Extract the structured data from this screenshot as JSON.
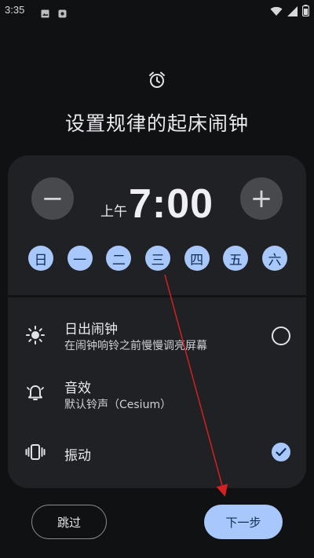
{
  "status_bar": {
    "time": "3:35"
  },
  "header": {
    "title": "设置规律的起床闹钟"
  },
  "alarm": {
    "ampm": "上午",
    "time": "7:00",
    "decrease_symbol": "−",
    "increase_symbol": "+",
    "days": [
      "日",
      "一",
      "二",
      "三",
      "四",
      "五",
      "六"
    ]
  },
  "options": [
    {
      "label": "日出闹钟",
      "sub": "在闹钟响铃之前慢慢调亮屏幕",
      "icon": "sun-icon",
      "state": "unchecked"
    },
    {
      "label": "音效",
      "sub": "默认铃声（Cesium）",
      "icon": "bell-icon"
    },
    {
      "label": "振动",
      "icon": "vibrate-icon",
      "state": "checked"
    }
  ],
  "footer": {
    "skip": "跳过",
    "next": "下一步"
  },
  "colors": {
    "accent": "#a8c7fa",
    "background": "#101113",
    "card": "#1f2124",
    "annotation_arrow": "#d42020"
  }
}
